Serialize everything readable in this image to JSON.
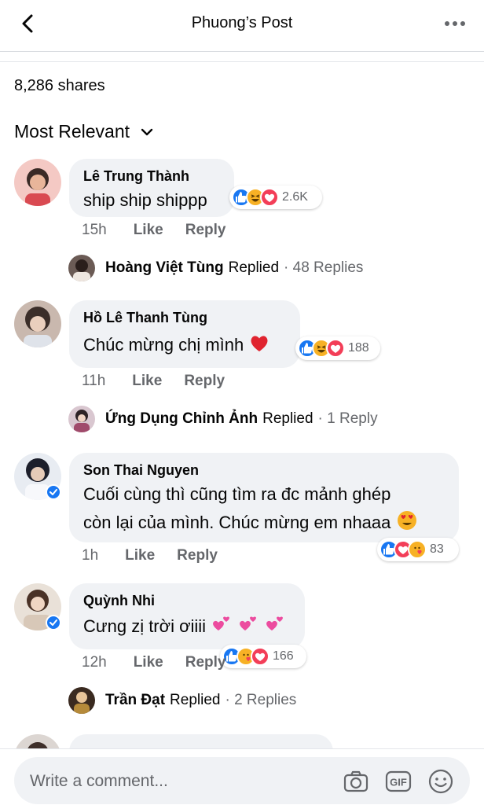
{
  "header": {
    "title": "Phuong’s Post"
  },
  "shares": "8,286 shares",
  "sort_label": "Most Relevant",
  "comments": [
    {
      "name": "Lê Trung Thành",
      "text": "ship ship shippp",
      "time": "15h",
      "like": "Like",
      "reply": "Reply",
      "reactions": [
        "like-icon",
        "haha-icon",
        "love-icon"
      ],
      "reaction_count": "2.6K",
      "reply_summary": {
        "name": "Hoàng Việt Tùng",
        "replied": "Replied",
        "count": "· 48 Replies"
      }
    },
    {
      "name": "Hồ Lê Thanh Tùng",
      "text": "Chúc mừng chị mình",
      "emoji": "red-heart",
      "time": "11h",
      "like": "Like",
      "reply": "Reply",
      "reactions": [
        "like-icon",
        "haha-icon",
        "love-icon"
      ],
      "reaction_count": "188",
      "reply_summary": {
        "name": "Ứng Dụng Chỉnh Ảnh",
        "replied": "Replied",
        "count": "· 1 Reply"
      }
    },
    {
      "name": "Son Thai Nguyen",
      "verified": true,
      "text_line1": "Cuối cùng thì cũng tìm ra đc mảnh ghép",
      "text_line2": "còn lại của mình. Chúc mừng em nhaaa",
      "emoji": "heart-eyes",
      "time": "1h",
      "like": "Like",
      "reply": "Reply",
      "reactions": [
        "like-icon",
        "love-icon",
        "care-icon"
      ],
      "reaction_count": "83"
    },
    {
      "name": "Quỳnh Nhi",
      "verified": true,
      "text": "Cưng zị trời ơiiii",
      "emoji": "two-hearts x3",
      "time": "12h",
      "like": "Like",
      "reply": "Reply",
      "reactions": [
        "like-icon",
        "care-icon",
        "love-icon"
      ],
      "reaction_count": "166",
      "reply_summary": {
        "name": "Trần Đạt",
        "replied": "Replied",
        "count": "· 2 Replies"
      }
    }
  ],
  "composer": {
    "placeholder": "Write a comment...",
    "gif_label": "GIF"
  },
  "colors": {
    "like": "#1877f2",
    "love": "#f33e58",
    "haha": "#f7b125",
    "bubble": "#f0f2f5",
    "secondary_text": "#65676b"
  }
}
